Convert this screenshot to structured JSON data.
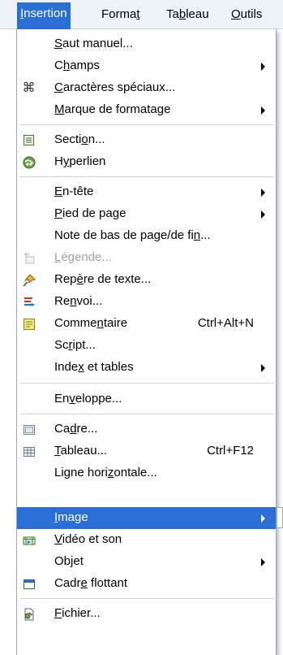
{
  "menubar": {
    "insertion": {
      "pre": "",
      "u": "I",
      "post": "nsertion"
    },
    "format": {
      "pre": "Forma",
      "u": "t",
      "post": ""
    },
    "tableau": {
      "pre": "Ta",
      "u": "b",
      "post": "leau"
    },
    "outils": {
      "pre": "",
      "u": "O",
      "post": "utils"
    }
  },
  "items": {
    "saut": {
      "pre": "",
      "u": "S",
      "post": "aut manuel..."
    },
    "champs": {
      "pre": "C",
      "u": "h",
      "post": "amps"
    },
    "caracteres": {
      "pre": "",
      "u": "C",
      "post": "aractères spéciaux..."
    },
    "marque": {
      "pre": "",
      "u": "M",
      "post": "arque de formatage"
    },
    "section": {
      "pre": "Secti",
      "u": "o",
      "post": "n..."
    },
    "hyperlien": {
      "pre": "H",
      "u": "y",
      "post": "perlien"
    },
    "entete": {
      "pre": "",
      "u": "E",
      "post": "n-tête"
    },
    "pied": {
      "pre": "",
      "u": "P",
      "post": "ied de page"
    },
    "note": {
      "pre": "Note de bas de page/de fi",
      "u": "n",
      "post": "..."
    },
    "legende": {
      "pre": "",
      "u": "L",
      "post": "égende..."
    },
    "repere": {
      "pre": "Rep",
      "u": "è",
      "post": "re de texte..."
    },
    "renvoi": {
      "pre": "Re",
      "u": "n",
      "post": "voi..."
    },
    "commentaire": {
      "pre": "Comme",
      "u": "n",
      "post": "taire",
      "shortcut": "Ctrl+Alt+N"
    },
    "script": {
      "pre": "Sc",
      "u": "r",
      "post": "ipt..."
    },
    "index": {
      "pre": "Inde",
      "u": "x",
      "post": " et tables"
    },
    "enveloppe": {
      "pre": "En",
      "u": "v",
      "post": "eloppe..."
    },
    "cadre": {
      "pre": "Ca",
      "u": "d",
      "post": "re..."
    },
    "tableau": {
      "pre": "",
      "u": "T",
      "post": "ableau...",
      "shortcut": "Ctrl+F12"
    },
    "ligne": {
      "pre": "Ligne hori",
      "u": "z",
      "post": "ontale..."
    },
    "image": {
      "pre": "",
      "u": "I",
      "post": "mage"
    },
    "video": {
      "pre": "",
      "u": "V",
      "post": "idéo et son"
    },
    "objet": {
      "pre": "Ob",
      "u": "j",
      "post": "et"
    },
    "cadreflottant": {
      "pre": "Cadr",
      "u": "e",
      "post": " flottant"
    },
    "fichier": {
      "pre": "",
      "u": "F",
      "post": "ichier..."
    }
  },
  "icons": {
    "caracteres": "⌘",
    "section": "section-icon",
    "hyperlien": "hyperlink-globe-icon",
    "legende": "caption-icon",
    "repere": "bookmark-pin-icon",
    "renvoi": "cross-reference-icon",
    "commentaire": "comment-icon",
    "cadre": "frame-icon",
    "tableau": "table-icon",
    "video": "video-icon",
    "cadreflottant": "floating-frame-icon",
    "fichier": "file-icon"
  },
  "colors": {
    "highlight": "#2a6fd6",
    "disabled_text": "#a3a3a3",
    "menubar_bg": "#eef3fa"
  }
}
